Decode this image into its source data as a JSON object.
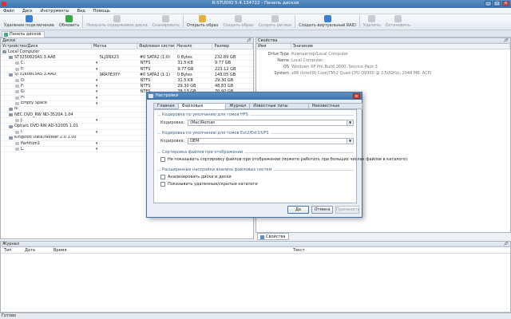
{
  "window": {
    "title": "R-STUDIO 5.4.134722 - Панель дисков",
    "controls": [
      "_",
      "□",
      "×"
    ]
  },
  "menu": [
    "Файл",
    "Диск",
    "Инструменты",
    "Вид",
    "Помощь"
  ],
  "toolbar": [
    {
      "label": "Удаление подключение",
      "icon": "delete-icon",
      "color": "#3a7fd0",
      "enabled": true
    },
    {
      "label": "Обновить",
      "icon": "refresh-icon",
      "color": "#38a848",
      "enabled": true
    },
    {
      "label": "Показать содержимое диска",
      "icon": "show-content-icon",
      "color": "#8a96a8",
      "enabled": false
    },
    {
      "label": "Сканировать",
      "icon": "scan-icon",
      "color": "#8a96a8",
      "enabled": false
    },
    {
      "label": "Открыть образ",
      "icon": "open-image-icon",
      "color": "#e4b23a",
      "enabled": true
    },
    {
      "label": "Создать образ",
      "icon": "create-image-icon",
      "color": "#8a96a8",
      "enabled": false
    },
    {
      "label": "Создать регион",
      "icon": "create-region-icon",
      "color": "#8a96a8",
      "enabled": false
    },
    {
      "label": "Создать виртуальный RAID",
      "icon": "raid-icon",
      "color": "#3a7fd0",
      "enabled": true
    },
    {
      "label": "Удалить",
      "icon": "remove-icon",
      "color": "#8a96a8",
      "enabled": false
    },
    {
      "label": "Остановить",
      "icon": "stop-icon",
      "color": "#8a96a8",
      "enabled": false
    }
  ],
  "tab": {
    "label": "Панель дисков"
  },
  "devices_panel": {
    "title": "Диски",
    "columns": [
      "Устройство/Диск",
      "Метка",
      "Файловая система",
      "Начало",
      "Размер"
    ],
    "rows": [
      {
        "name": "Local Computer",
        "indent": 0,
        "type": "computer",
        "media": "",
        "fs": "",
        "label": "",
        "start": "",
        "size": ""
      },
      {
        "name": "ST3250820AS 3.AAE",
        "indent": 1,
        "type": "disk",
        "media": "5LJ3NX23",
        "fs": "#0 SATA2 (1:0)",
        "label": "0 Bytes",
        "start": "",
        "size": "232.89 GB"
      },
      {
        "name": "C:",
        "indent": 2,
        "type": "part",
        "media": "",
        "fs": "NTFS",
        "label": "31.5 KB",
        "start": "",
        "size": "9.77 GB"
      },
      {
        "name": "E:",
        "indent": 2,
        "type": "part",
        "media": "",
        "fs": "NTFS",
        "label": "9.77 GB",
        "start": "",
        "size": "223.12 GB"
      },
      {
        "name": "ST3160815AS 3.AAD",
        "indent": 1,
        "type": "disk",
        "media": "9RA7E3YY",
        "fs": "#0 SATA2 (1:1)",
        "label": "0 Bytes",
        "start": "",
        "size": "149.05 GB"
      },
      {
        "name": "D:",
        "indent": 2,
        "type": "part",
        "media": "",
        "fs": "NTFS",
        "label": "31.5 KB",
        "start": "",
        "size": "29.30 GB"
      },
      {
        "name": "F:",
        "indent": 2,
        "type": "part",
        "media": "",
        "fs": "NTFS",
        "label": "29.30 GB",
        "start": "",
        "size": "48.83 GB"
      },
      {
        "name": "G:",
        "indent": 2,
        "type": "part",
        "media": "",
        "fs": "NTFS",
        "label": "78.13 GB",
        "start": "",
        "size": "70.92 GB"
      },
      {
        "name": "H:",
        "indent": 2,
        "type": "part",
        "media": "",
        "fs": "",
        "label": "",
        "start": "",
        "size": ""
      },
      {
        "name": "Empty Space",
        "indent": 2,
        "type": "part",
        "media": "",
        "fs": "",
        "label": "",
        "start": "",
        "size": ""
      },
      {
        "name": "N:",
        "indent": 1,
        "type": "disk",
        "media": "",
        "fs": "",
        "label": "",
        "start": "",
        "size": ""
      },
      {
        "name": "NEC DVD_RW ND-3520A 1.04",
        "indent": 1,
        "type": "disk",
        "media": "",
        "fs": "",
        "label": "",
        "start": "",
        "size": ""
      },
      {
        "name": "J:",
        "indent": 2,
        "type": "part",
        "media": "",
        "fs": "",
        "label": "",
        "start": "",
        "size": ""
      },
      {
        "name": "Optiarc DVD RW AD-5200S 1.01",
        "indent": 1,
        "type": "disk",
        "media": "",
        "fs": "",
        "label": "",
        "start": "",
        "size": ""
      },
      {
        "name": "I:",
        "indent": 2,
        "type": "part",
        "media": "",
        "fs": "",
        "label": "",
        "start": "",
        "size": ""
      },
      {
        "name": "Kingston DataTraveler 2.0 1.00",
        "indent": 1,
        "type": "disk",
        "media": "",
        "fs": "",
        "label": "",
        "start": "",
        "size": ""
      },
      {
        "name": "Partition1",
        "indent": 2,
        "type": "part",
        "media": "",
        "fs": "",
        "label": "",
        "start": "",
        "size": ""
      },
      {
        "name": "L:",
        "indent": 2,
        "type": "part",
        "media": "",
        "fs": "",
        "label": "",
        "start": "",
        "size": ""
      }
    ]
  },
  "properties_panel": {
    "title": "Свойства",
    "columns": [
      "Имя",
      "Значение"
    ],
    "rows": [
      {
        "key": "Drive Type",
        "value": "Компьютер/Local Computer"
      },
      {
        "key": "Name",
        "value": "Local Computer"
      },
      {
        "key": "OS",
        "value": "Windows XP Pro Build 2600, Service Pack 3"
      },
      {
        "key": "System",
        "value": "x86 (Intel(R) Core(TM)2 Quad CPU Q9300 @ 2.50GHz), 2048 MB, ACPI"
      }
    ],
    "tab_label": "Свойства"
  },
  "journal_panel": {
    "title": "Журнал",
    "columns": [
      "Тип",
      "Дата",
      "Время",
      "Текст"
    ]
  },
  "status": {
    "text": "Готово"
  },
  "dialog": {
    "title": "Настройки",
    "tabs": [
      "Главная",
      "Файловые системы",
      "Журнал",
      "Известные типы файлов",
      "Неизвестные системы"
    ],
    "group_nfs": "Кодировка по умолчанию для томов HFS",
    "encoding_label": "Кодировка:",
    "encoding_value": "(Mac)Roman",
    "group_ext": "Кодировка по умолчанию для томов Ext2/Ext3/UFS",
    "encoding2_value": "OEM",
    "group_sort": "Сортировка файлов при отображении",
    "sort_option": "Не показывать сортировку файлов при отображении (можете работать при больших числах файлов в каталоге)",
    "group_adv": "Расширенные настройки анализа файловых систем",
    "adv_option1": "Анализировать диски и диски",
    "adv_option2": "Показывать удаленные/скрытые каталоги",
    "buttons": {
      "ok": "Да",
      "cancel": "Отмена",
      "apply": "Применить"
    }
  }
}
